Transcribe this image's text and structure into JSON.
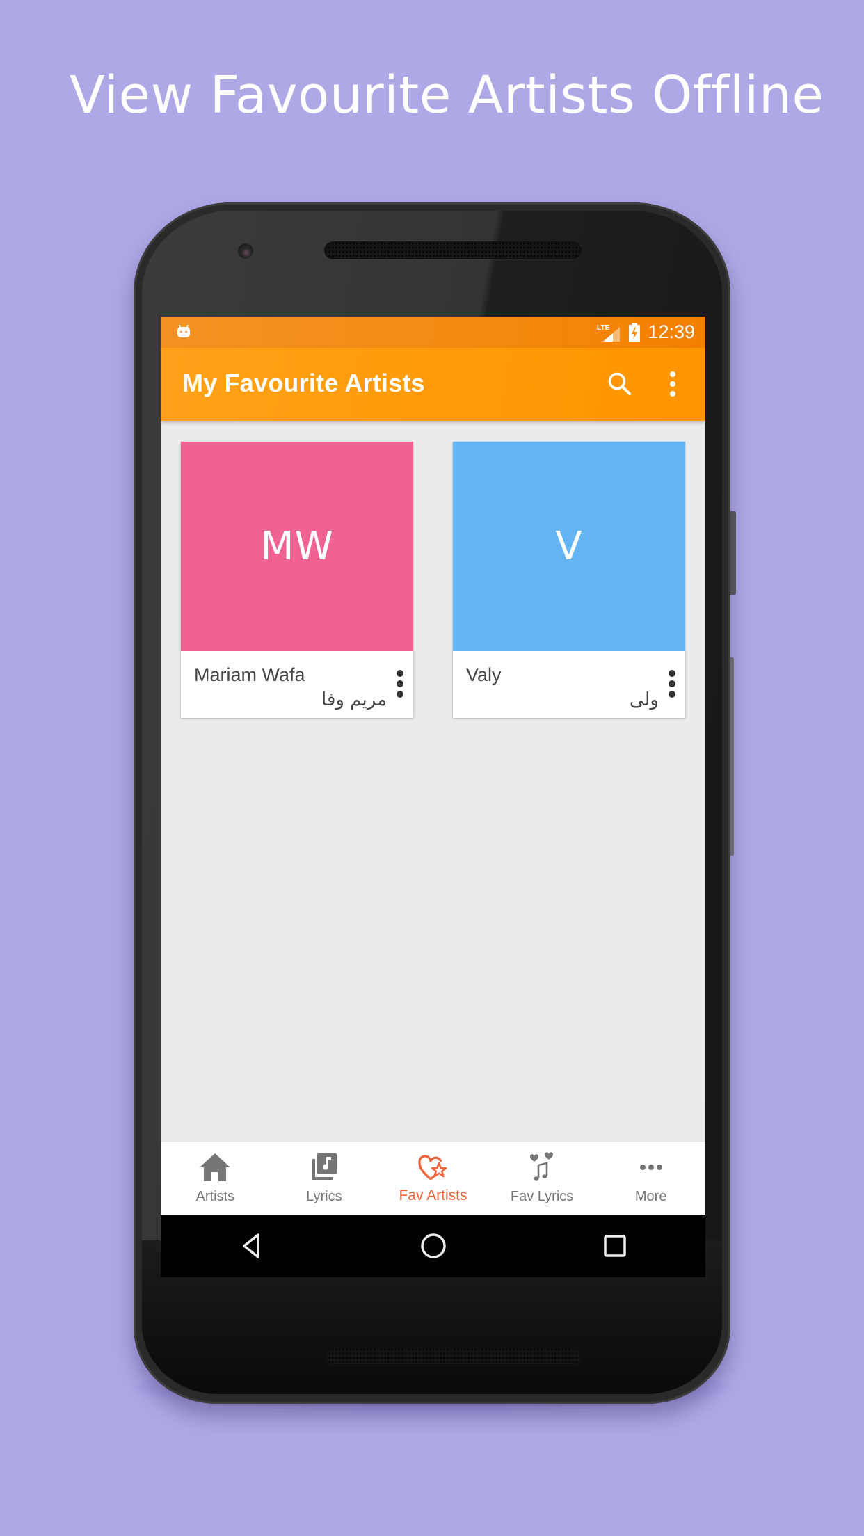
{
  "headline": "View Favourite Artists Offline",
  "status_bar": {
    "notification_icon": "android-icon",
    "network": "LTE",
    "signal_icon": "signal-icon",
    "battery_icon": "battery-charging-icon",
    "time": "12:39"
  },
  "app_bar": {
    "title": "My Favourite Artists",
    "search_icon": "search-icon",
    "more_icon": "more-vert-icon"
  },
  "artists": [
    {
      "initials": "MW",
      "name": "Mariam Wafa",
      "native_name": "مریم وفا",
      "color": "#f06292"
    },
    {
      "initials": "V",
      "name": "Valy",
      "native_name": "ولی",
      "color": "#64b5f6"
    }
  ],
  "bottom_nav": {
    "active_index": 2,
    "active_color": "#f0643c",
    "inactive_color": "#757575",
    "items": [
      {
        "label": "Artists",
        "icon": "home-icon"
      },
      {
        "label": "Lyrics",
        "icon": "library-music-icon"
      },
      {
        "label": "Fav Artists",
        "icon": "heart-star-icon"
      },
      {
        "label": "Fav Lyrics",
        "icon": "music-hearts-icon"
      },
      {
        "label": "More",
        "icon": "more-horiz-icon"
      }
    ]
  },
  "system_nav": [
    "back",
    "home",
    "recents"
  ],
  "colors": {
    "background": "#aea8e6",
    "app_bar": "#ff9800",
    "status_bar": "#f57c00"
  }
}
